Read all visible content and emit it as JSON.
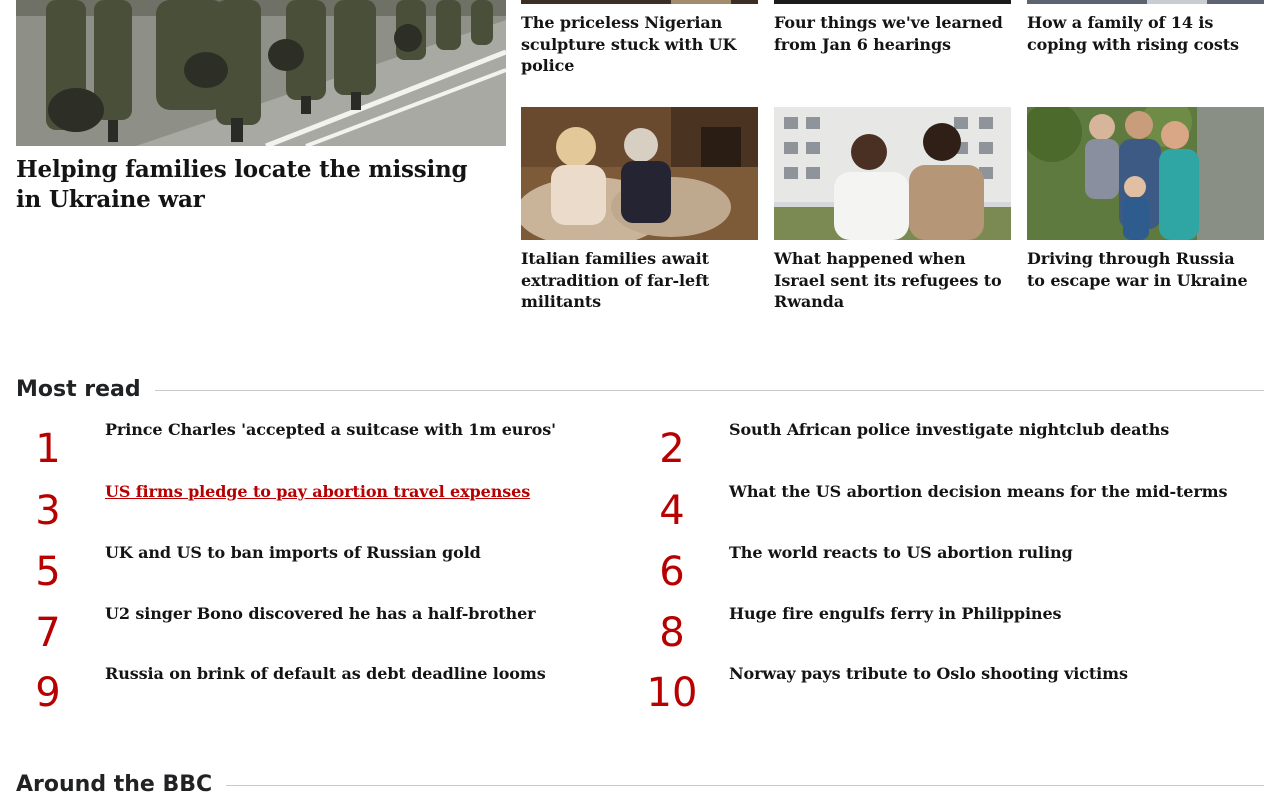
{
  "lead_story": {
    "headline": "Helping families locate the missing in Ukraine war"
  },
  "top_stories": [
    {
      "headline": "The priceless Nigerian sculpture stuck with UK police"
    },
    {
      "headline": "Four things we've learned from Jan 6 hearings"
    },
    {
      "headline": "How a family of 14 is coping with rising costs"
    }
  ],
  "image_stories": [
    {
      "headline": "Italian families await extradition of far-left militants"
    },
    {
      "headline": "What happened when Israel sent its refugees to Rwanda"
    },
    {
      "headline": "Driving through Russia to escape war in Ukraine"
    }
  ],
  "most_read": {
    "heading": "Most read",
    "items": [
      {
        "rank": "1",
        "title": "Prince Charles 'accepted a suitcase with 1m euros'"
      },
      {
        "rank": "2",
        "title": "South African police investigate nightclub deaths"
      },
      {
        "rank": "3",
        "title": "US firms pledge to pay abortion travel expenses"
      },
      {
        "rank": "4",
        "title": "What the US abortion decision means for the mid-terms"
      },
      {
        "rank": "5",
        "title": "UK and US to ban imports of Russian gold"
      },
      {
        "rank": "6",
        "title": "The world reacts to US abortion ruling"
      },
      {
        "rank": "7",
        "title": "U2 singer Bono discovered he has a half-brother"
      },
      {
        "rank": "8",
        "title": "Huge fire engulfs ferry in Philippines"
      },
      {
        "rank": "9",
        "title": "Russia on brink of default as debt deadline looms"
      },
      {
        "rank": "10",
        "title": "Norway pays tribute to Oslo shooting victims"
      }
    ]
  },
  "around_bbc": {
    "heading": "Around the BBC"
  },
  "colors": {
    "accent": "#b80000",
    "text": "#141414",
    "rule": "#c9c9c9"
  }
}
